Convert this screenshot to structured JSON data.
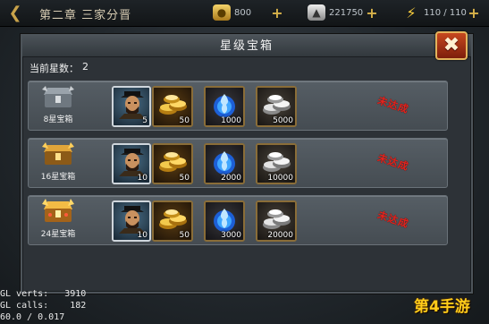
{
  "hud": {
    "chapter": "第二章 三家分晋",
    "gold": "800",
    "silver": "221750",
    "energy": "110 / 110"
  },
  "panel": {
    "title": "星级宝箱",
    "stars_label": "当前星数：",
    "stars_value": "2"
  },
  "colors": {
    "status_red": "#e3231d",
    "gold_border": "#8a6d38",
    "accent_gold": "#d8b24a"
  },
  "rows": [
    {
      "chest_label": "8星宝箱",
      "chest_icon": "silver-chest-icon",
      "rewards": [
        {
          "type": "hero",
          "icon": "hero-portrait-icon",
          "qty": "5"
        },
        {
          "type": "gold",
          "icon": "gold-ingot-icon",
          "qty": "50"
        },
        {
          "type": "blue",
          "icon": "blue-flame-icon",
          "qty": "1000"
        },
        {
          "type": "silver",
          "icon": "silver-ingot-icon",
          "qty": "5000"
        }
      ],
      "status": "未达成"
    },
    {
      "chest_label": "16星宝箱",
      "chest_icon": "gold-chest-icon",
      "rewards": [
        {
          "type": "hero",
          "icon": "hero-portrait-icon",
          "qty": "10"
        },
        {
          "type": "gold",
          "icon": "gold-ingot-icon",
          "qty": "50"
        },
        {
          "type": "blue",
          "icon": "blue-flame-icon",
          "qty": "2000"
        },
        {
          "type": "silver",
          "icon": "silver-ingot-icon",
          "qty": "10000"
        }
      ],
      "status": "未达成"
    },
    {
      "chest_label": "24星宝箱",
      "chest_icon": "ornate-gold-chest-icon",
      "rewards": [
        {
          "type": "hero",
          "icon": "hero-portrait-icon",
          "qty": "10"
        },
        {
          "type": "gold",
          "icon": "gold-ingot-icon",
          "qty": "50"
        },
        {
          "type": "blue",
          "icon": "blue-flame-icon",
          "qty": "3000"
        },
        {
          "type": "silver",
          "icon": "silver-ingot-icon",
          "qty": "20000"
        }
      ],
      "status": "未达成"
    }
  ],
  "debug": {
    "line1": "GL verts:   3910",
    "line2": "GL calls:    182",
    "line3": "60.0 / 0.017"
  },
  "watermark": "第4手游"
}
